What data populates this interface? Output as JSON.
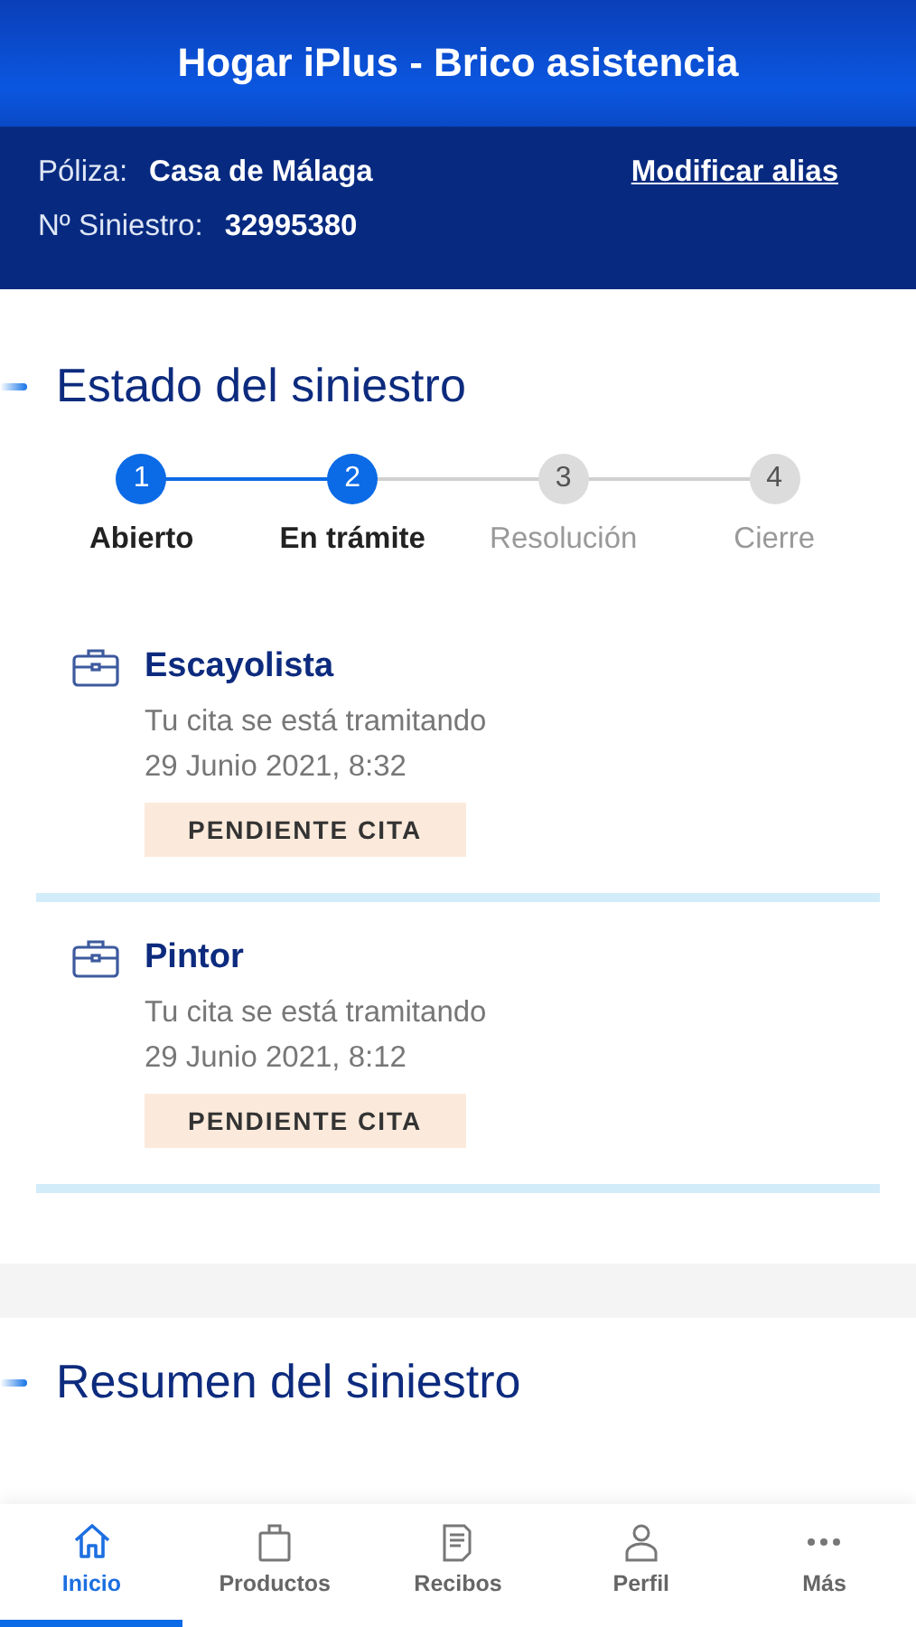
{
  "header": {
    "title": "Hogar iPlus - Brico asistencia"
  },
  "claim": {
    "policy_label": "Póliza:",
    "policy_value": "Casa de Málaga",
    "number_label": "Nº Siniestro:",
    "number_value": "32995380",
    "link": "Modificar alias"
  },
  "status": {
    "title": "Estado del siniestro",
    "steps": [
      {
        "number": "1",
        "label": "Abierto",
        "completed": true
      },
      {
        "number": "2",
        "label": "En trámite",
        "completed": true
      },
      {
        "number": "3",
        "label": "Resolución",
        "completed": false
      },
      {
        "number": "4",
        "label": "Cierre",
        "completed": false
      }
    ]
  },
  "services": [
    {
      "title": "Escayolista",
      "message": "Tu cita se está tramitando",
      "date": "29 Junio 2021, 8:32",
      "badge": "PENDIENTE CITA"
    },
    {
      "title": "Pintor",
      "message": "Tu cita se está tramitando",
      "date": "29 Junio 2021, 8:12",
      "badge": "PENDIENTE CITA"
    }
  ],
  "summary": {
    "title": "Resumen del siniestro"
  },
  "tabs": [
    {
      "label": "Inicio",
      "kind": "home",
      "selected": true
    },
    {
      "label": "Productos",
      "kind": "bag",
      "selected": false
    },
    {
      "label": "Recibos",
      "kind": "receipt",
      "selected": false
    },
    {
      "label": "Perfil",
      "kind": "person",
      "selected": false
    },
    {
      "label": "Más",
      "kind": "more",
      "selected": false
    }
  ]
}
